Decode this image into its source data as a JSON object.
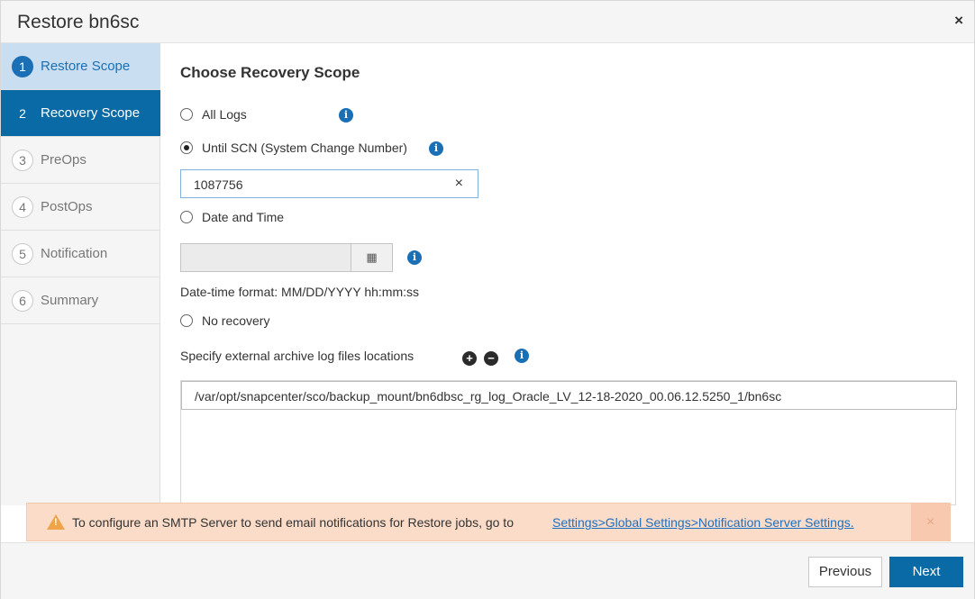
{
  "dialog": {
    "title": "Restore bn6sc",
    "close_glyph": "×"
  },
  "sidebar": {
    "steps": [
      {
        "number": "1",
        "label": "Restore Scope",
        "state": "done"
      },
      {
        "number": "2",
        "label": "Recovery Scope",
        "state": "active"
      },
      {
        "number": "3",
        "label": "PreOps",
        "state": "pending"
      },
      {
        "number": "4",
        "label": "PostOps",
        "state": "pending"
      },
      {
        "number": "5",
        "label": "Notification",
        "state": "pending"
      },
      {
        "number": "6",
        "label": "Summary",
        "state": "pending"
      }
    ]
  },
  "main": {
    "heading": "Choose Recovery Scope",
    "options": {
      "all_logs": {
        "label": "All Logs",
        "selected": false
      },
      "until_scn": {
        "label": "Until SCN (System Change Number)",
        "selected": true
      },
      "date_time": {
        "label": "Date and Time",
        "selected": false
      },
      "no_recovery": {
        "label": "No recovery",
        "selected": false
      }
    },
    "scn_value": "1087756",
    "clear_glyph": "×",
    "date_value": "",
    "calendar_glyph": "▦",
    "date_format": "Date-time format: MM/DD/YYYY hh:mm:ss",
    "archive_label": "Specify external archive log files locations",
    "add_glyph": "+",
    "remove_glyph": "−",
    "archive_paths": [
      "/var/opt/snapcenter/sco/backup_mount/bn6dbsc_rg_log_Oracle_LV_12-18-2020_00.06.12.5250_1/bn6sc"
    ],
    "info_glyph": "i"
  },
  "alert": {
    "text": "To configure an SMTP Server to send email notifications for Restore jobs, go to",
    "link": "Settings>Global Settings>Notification Server Settings.",
    "close_glyph": "×"
  },
  "footer": {
    "previous_label": "Previous",
    "next_label": "Next"
  },
  "colors": {
    "accent": "#0a6aa6",
    "step_done_bg": "#c9dff1",
    "alert_bg": "#fbdcc8",
    "warning": "#f0a44a",
    "link": "#1f6fc0"
  }
}
